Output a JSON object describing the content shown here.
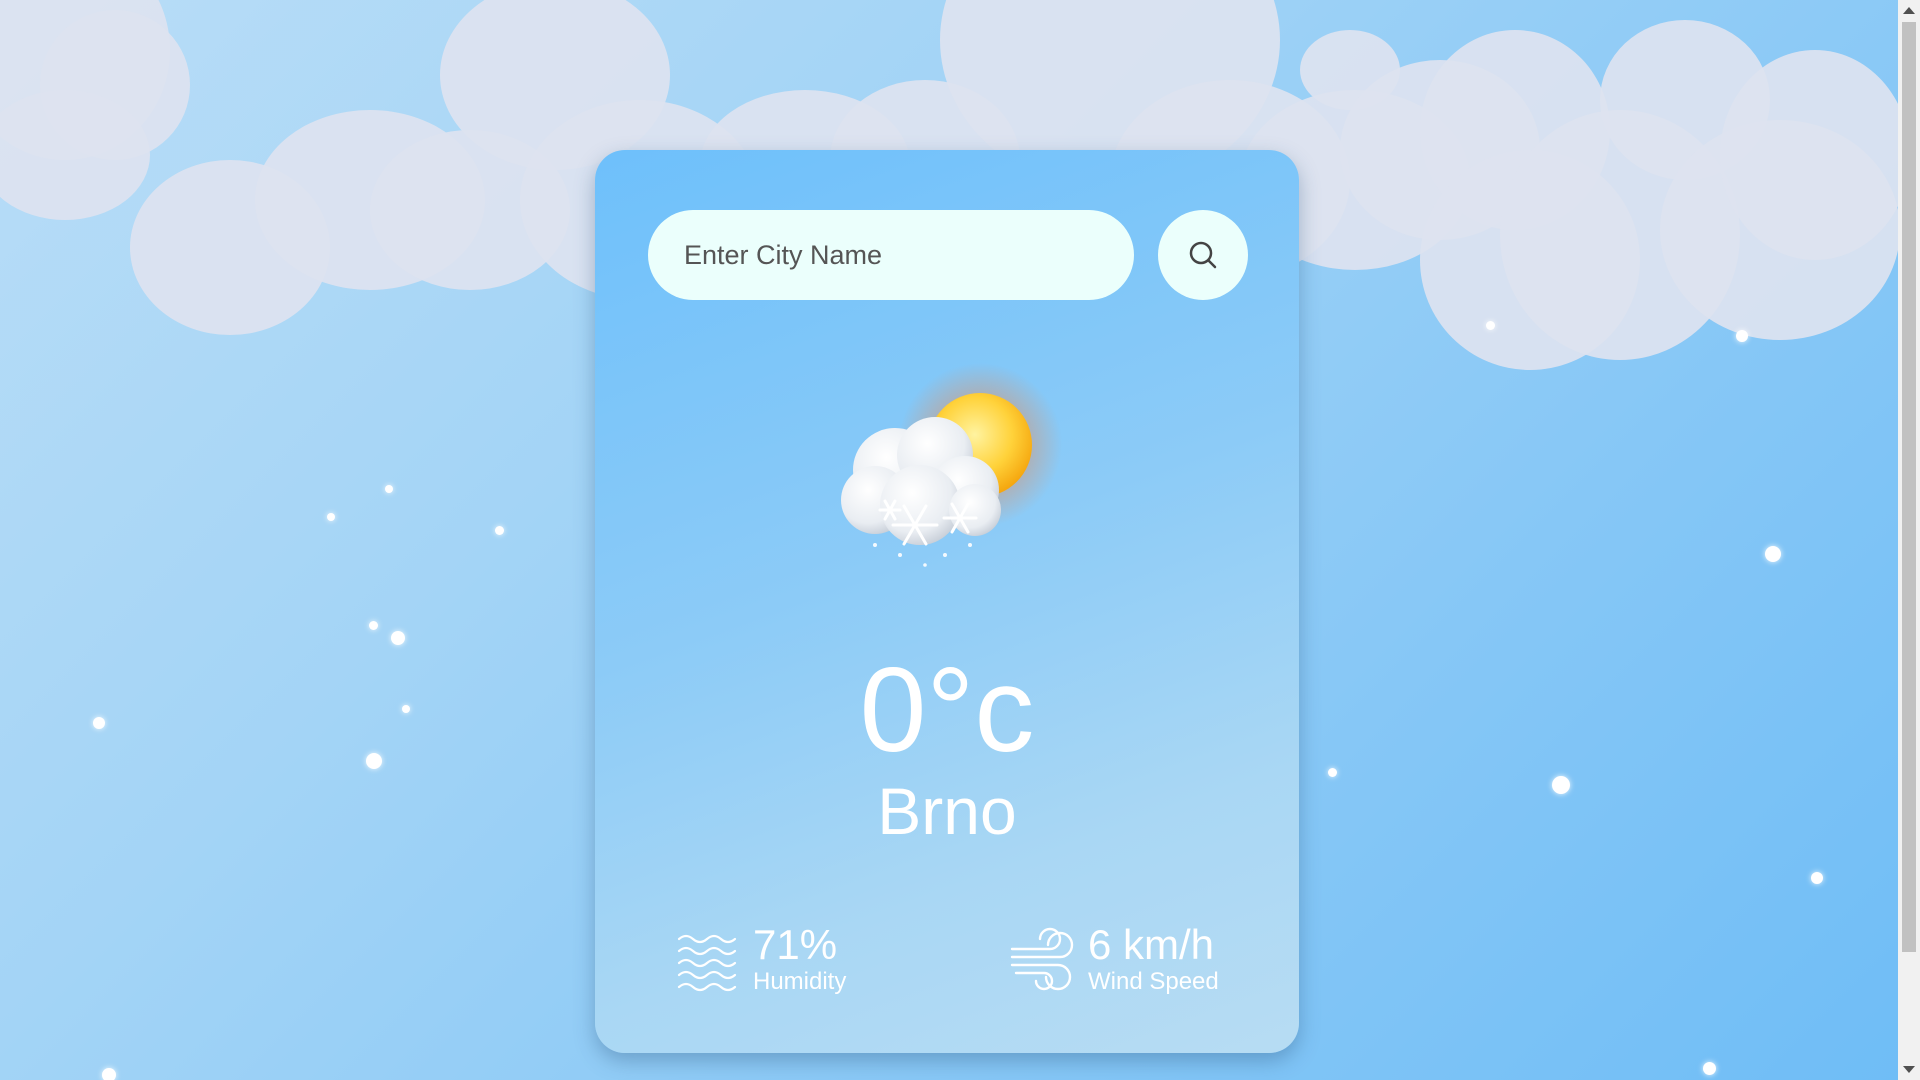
{
  "search": {
    "placeholder": "Enter City Name",
    "value": ""
  },
  "weather": {
    "icon": "snow-sun-cloud-icon",
    "temperature": "0°c",
    "city": "Brno"
  },
  "stats": {
    "humidity": {
      "value": "71%",
      "label": "Humidity",
      "icon": "humidity-waves-icon"
    },
    "wind": {
      "value": "6 km/h",
      "label": "Wind Speed",
      "icon": "wind-icon"
    }
  },
  "colors": {
    "background": "#8fcaf6",
    "card": "#8ccbf7",
    "input": "#ebfffc",
    "text": "#ffffff",
    "cloud": "#dde3f0"
  }
}
